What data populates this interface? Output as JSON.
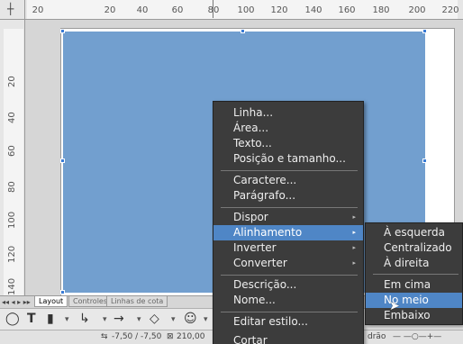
{
  "ruler": {
    "h_ticks": [
      "20",
      "20",
      "40",
      "60",
      "80",
      "100",
      "120",
      "140",
      "160",
      "180",
      "200",
      "220"
    ],
    "v_ticks": [
      "20",
      "40",
      "60",
      "80",
      "100",
      "120",
      "140"
    ]
  },
  "tabs": [
    "Layout",
    "Controles",
    "Linhas de cota"
  ],
  "tab_nav": "◂◂ ◂ ▸ ▸▸",
  "status": {
    "coords": "-7,50 / -7,50",
    "size": "210,00",
    "style": "drão"
  },
  "context_menu": {
    "items": [
      {
        "label": "Linha..."
      },
      {
        "label": "Área..."
      },
      {
        "label": "Texto..."
      },
      {
        "label": "Posição e tamanho..."
      },
      {
        "label": "Caractere..."
      },
      {
        "label": "Parágrafo..."
      },
      {
        "label": "Dispor",
        "submenu": true
      },
      {
        "label": "Alinhamento",
        "submenu": true,
        "selected": true
      },
      {
        "label": "Inverter",
        "submenu": true
      },
      {
        "label": "Converter",
        "submenu": true
      },
      {
        "label": "Descrição..."
      },
      {
        "label": "Nome..."
      },
      {
        "label": "Editar estilo..."
      },
      {
        "label": "Cortar"
      }
    ]
  },
  "align_submenu": {
    "items": [
      {
        "label": "À esquerda"
      },
      {
        "label": "Centralizado"
      },
      {
        "label": "À direita"
      },
      {
        "label": "Em cima"
      },
      {
        "label": "No meio",
        "selected": true
      },
      {
        "label": "Embaixo"
      }
    ]
  },
  "toolbar": {
    "icons": [
      "select-icon",
      "text-icon",
      "line-color-icon",
      "connector-icon",
      "arrow-icon",
      "shapes-icon",
      "symbol-icon"
    ]
  },
  "colors": {
    "rect_fill": "#729fcf",
    "menu_bg": "#3c3c3c",
    "menu_highlight": "#4f86c6"
  }
}
